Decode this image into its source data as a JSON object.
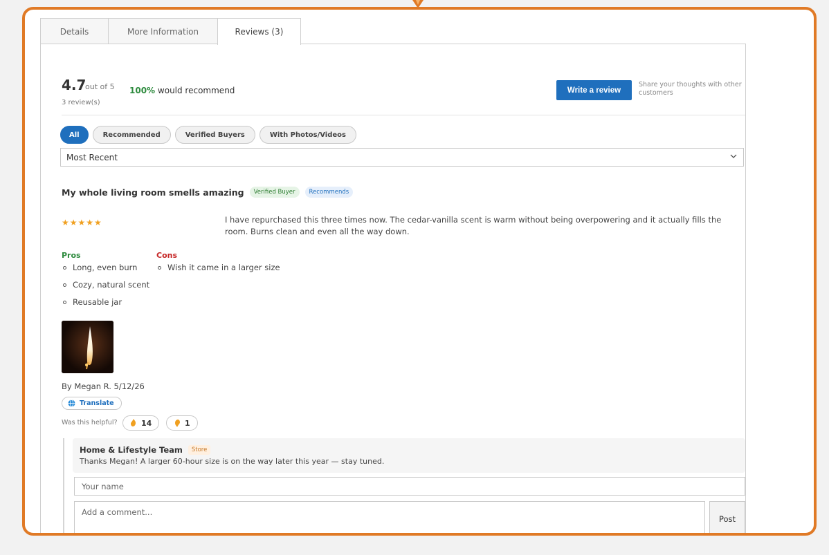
{
  "tabs": [
    {
      "label": "Details"
    },
    {
      "label": "More Information"
    },
    {
      "label": "Reviews (3)"
    }
  ],
  "summary": {
    "score": "4.7",
    "out_of": "out of 5",
    "count": "3 review(s)",
    "recommend_pct": "100%",
    "recommend_text": "would recommend",
    "write_button": "Write a review",
    "write_hint": "Share your thoughts with other customers"
  },
  "filters": [
    "All",
    "Recommended",
    "Verified Buyers",
    "With Photos/Videos"
  ],
  "sort": {
    "selected": "Most Recent"
  },
  "review": {
    "title": "My whole living room smells amazing",
    "badge_verified": "Verified Buyer",
    "badge_recommends": "Recommends",
    "stars": "★★★★★",
    "rating": 5,
    "body": "I have repurchased this three times now. The cedar-vanilla scent is warm without being overpowering and it actually fills the room. Burns clean and even all the way down.",
    "pros_heading": "Pros",
    "cons_heading": "Cons",
    "pros": [
      "Long, even burn",
      "Cozy, natural scent",
      "Reusable jar"
    ],
    "cons": [
      "Wish it came in a larger size"
    ],
    "byline": "By Megan R. 5/12/26",
    "translate": "Translate",
    "helpful_label": "Was this helpful?",
    "helpful_up": "14",
    "helpful_down": "1"
  },
  "reply": {
    "author": "Home & Lifestyle Team",
    "badge": "Store",
    "text": "Thanks Megan! A larger 60-hour size is on the way later this year — stay tuned."
  },
  "comment_form": {
    "name_placeholder": "Your name",
    "comment_placeholder": "Add a comment...",
    "post_button": "Post"
  },
  "colors": {
    "frame": "#e07a26",
    "primary": "#1f6fbd",
    "pros": "#2e8b3e",
    "cons": "#c62828",
    "stars": "#f0a020"
  }
}
